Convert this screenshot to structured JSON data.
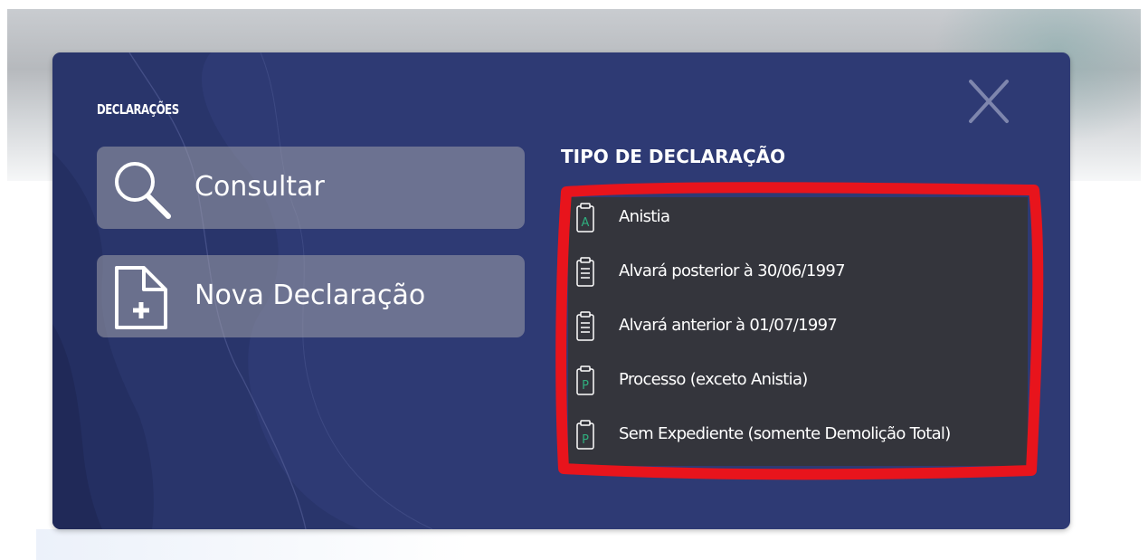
{
  "modal": {
    "title": "DECLARAÇÕES",
    "close_label": "X",
    "colors": {
      "panel": "#2e3a74",
      "list_bg": "#34353c",
      "highlight": "#e8141c",
      "icon_letter": "#2fae7e"
    }
  },
  "actions": [
    {
      "label": "Consultar",
      "icon": "search-icon"
    },
    {
      "label": "Nova Declaração",
      "icon": "new-document-icon"
    }
  ],
  "declaration_types": {
    "heading": "TIPO DE DECLARAÇÃO",
    "items": [
      {
        "label": "Anistia",
        "icon": "clipboard-letter-icon",
        "icon_letter": "A"
      },
      {
        "label": "Alvará posterior à 30/06/1997",
        "icon": "clipboard-list-icon"
      },
      {
        "label": "Alvará anterior à 01/07/1997",
        "icon": "clipboard-list-icon"
      },
      {
        "label": "Processo (exceto Anistia)",
        "icon": "clipboard-letter-icon",
        "icon_letter": "P"
      },
      {
        "label": "Sem Expediente (somente Demolição Total)",
        "icon": "clipboard-letter-icon",
        "icon_letter": "P"
      }
    ]
  }
}
